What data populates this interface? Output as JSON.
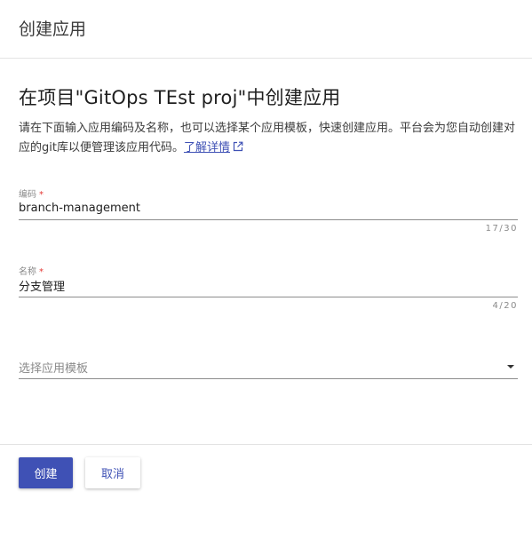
{
  "header": {
    "title": "创建应用"
  },
  "main": {
    "heading": "在项目\"GitOps TEst proj\"中创建应用",
    "description": "请在下面输入应用编码及名称，也可以选择某个应用模板，快速创建应用。平台会为您自动创建对应的git库以便管理该应用代码。",
    "learn_more_link": "了解详情",
    "link_icon": "external-link-icon"
  },
  "form": {
    "code": {
      "label": "编码",
      "required_mark": "*",
      "value": "branch-management",
      "counter": "17/30"
    },
    "name": {
      "label": "名称",
      "required_mark": "*",
      "value": "分支管理",
      "counter": "4/20"
    },
    "template": {
      "placeholder": "选择应用模板",
      "icon": "caret-down-icon"
    }
  },
  "footer": {
    "create_label": "创建",
    "cancel_label": "取消"
  },
  "colors": {
    "primary": "#3f51b5",
    "required": "#e53935",
    "divider": "#e3e3e3"
  }
}
